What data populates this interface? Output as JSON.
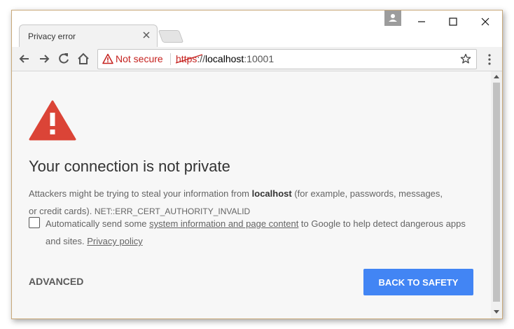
{
  "tab": {
    "title": "Privacy error"
  },
  "omnibox": {
    "security_label": "Not secure",
    "url_scheme": "https",
    "url_sep": "://",
    "url_host": "localhost",
    "url_port": ":10001"
  },
  "page": {
    "heading": "Your connection is not private",
    "desc_before": "Attackers might be trying to steal your information from ",
    "desc_host": "localhost",
    "desc_after": " (for example, passwords, messages, or credit cards). ",
    "error_code": "NET::ERR_CERT_AUTHORITY_INVALID",
    "checkbox_before": "Automatically send some ",
    "checkbox_link": "system information and page content",
    "checkbox_after": " to Google to help detect dangerous apps and sites. ",
    "privacy_link": "Privacy policy",
    "advanced_label": "ADVANCED",
    "back_label": "BACK TO SAFETY"
  },
  "colors": {
    "warning_red": "#db4437",
    "button_blue": "#4285f4",
    "not_secure_red": "#c5221f"
  }
}
